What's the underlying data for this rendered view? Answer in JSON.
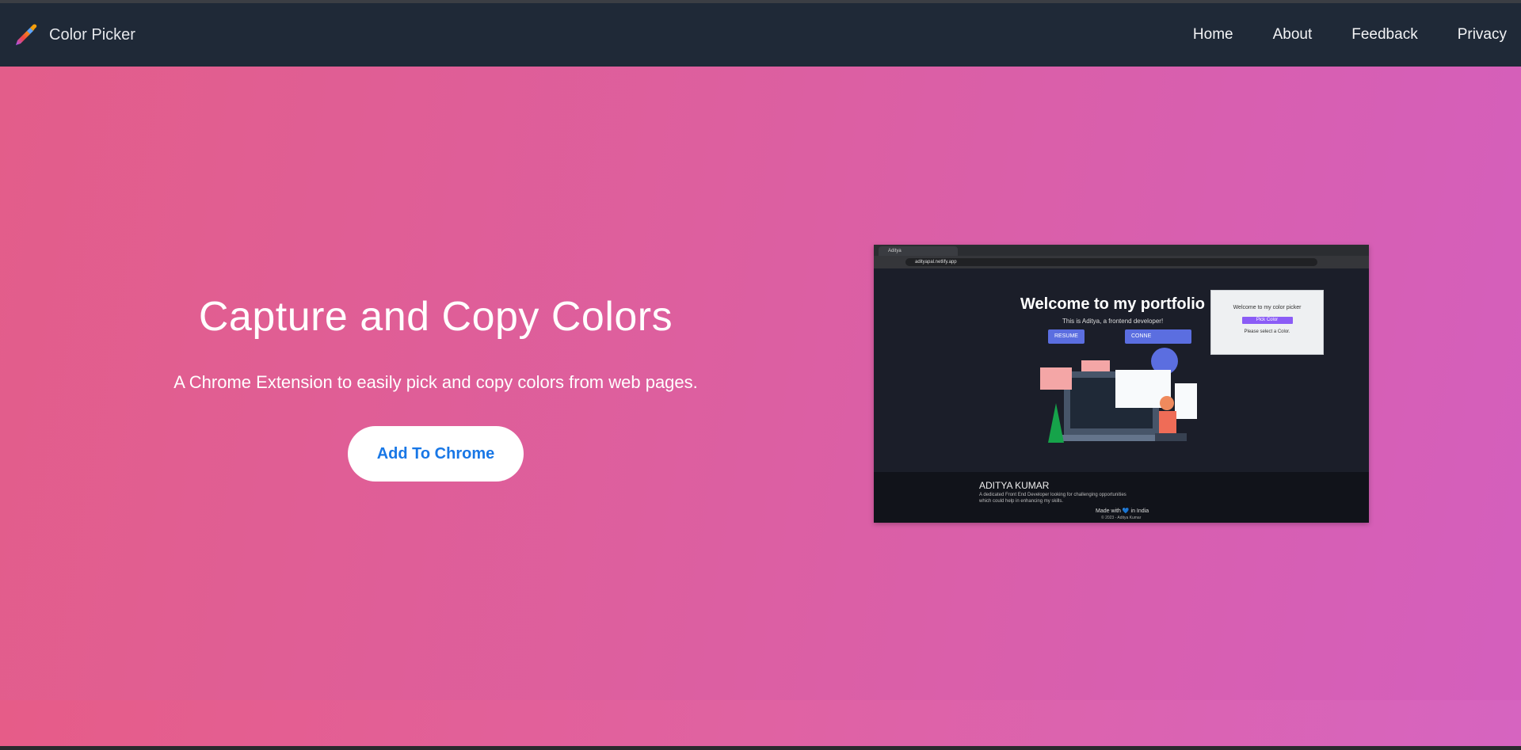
{
  "navbar": {
    "brand_name": "Color Picker",
    "links": [
      "Home",
      "About",
      "Feedback",
      "Privacy"
    ]
  },
  "hero": {
    "title": "Capture and Copy Colors",
    "subtitle": "A Chrome Extension to easily pick and copy colors from web pages.",
    "cta_label": "Add To Chrome"
  },
  "preview": {
    "tab_title": "Aditya",
    "url": "adityapal.netlify.app",
    "heading": "Welcome to my portfolio",
    "subheading": "This is Aditya, a frontend developer!",
    "button_resume": "RESUME",
    "button_connect": "CONNE",
    "popup": {
      "title": "Welcome to my color picker",
      "button": "Pick Color",
      "note": "Please select a Color."
    },
    "footer_name": "ADITYA KUMAR",
    "footer_desc": "A dedicated Front End Developer looking for challenging opportunities which could help in enhancing my skills.",
    "made_with": "Made with 💙 in India",
    "copyright": "© 2023 - Aditya Kumar"
  },
  "colors": {
    "navbar_bg": "#1f2937",
    "cta_text": "#1877e6",
    "hero_gradient_start": "#e35d8a",
    "hero_gradient_end": "#d45fbd"
  },
  "icons": [
    "eyedropper-logo-icon"
  ]
}
